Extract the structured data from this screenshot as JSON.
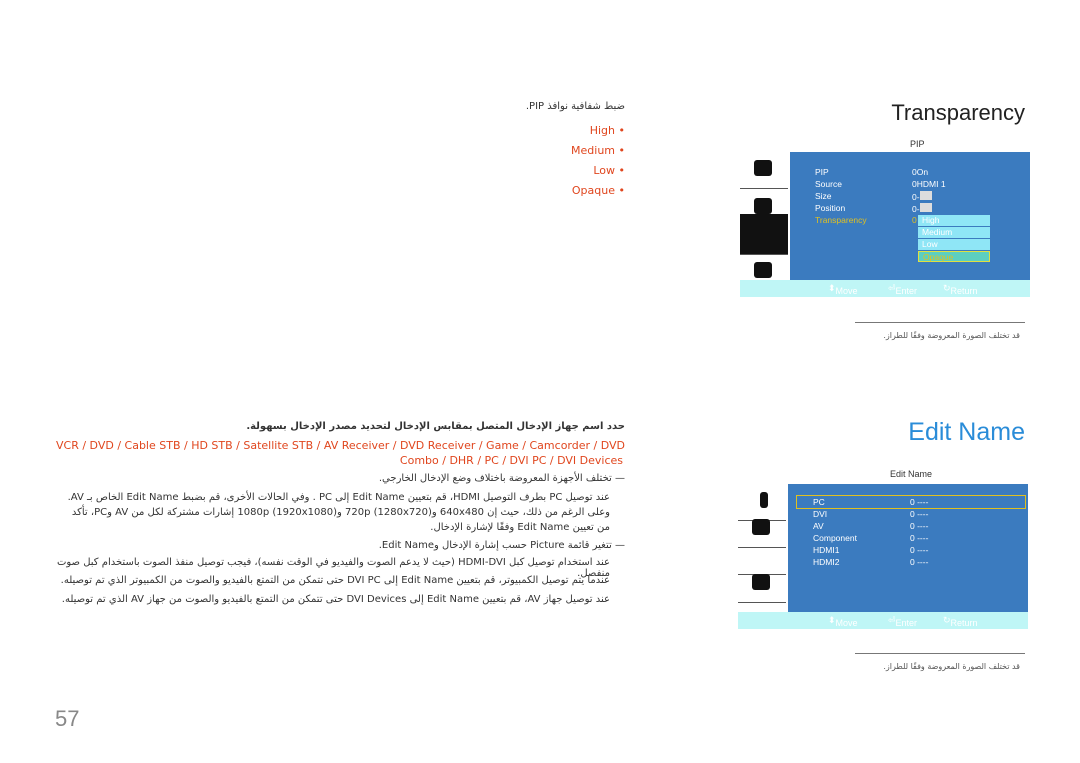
{
  "transparency": {
    "title": "Transparency",
    "intro": "ضبط شفافية نوافذ PIP.",
    "options": [
      "High",
      "Medium",
      "Low",
      "Opaque"
    ],
    "osd": {
      "title": "PIP",
      "rows": [
        {
          "label": "PIP",
          "value": "On"
        },
        {
          "label": "Source",
          "value": "HDMI 1"
        },
        {
          "label": "Size",
          "value": ""
        },
        {
          "label": "Position",
          "value": ""
        },
        {
          "label": "Transparency",
          "value": ""
        }
      ],
      "dropdown": [
        "High",
        "Medium",
        "Low",
        "Opaque"
      ],
      "footer": {
        "move": "Move",
        "enter": "Enter",
        "return": "Return"
      }
    },
    "note": "قد تختلف الصورة المعروضة وفقًا للطراز."
  },
  "edit_name": {
    "title": "Edit Name",
    "intro": "حدد اسم جهاز الإدخال المتصل بمقابس الإدخال لتحديد مصدر الإدخال بسهولة.",
    "devices_line1": "VCR / DVD / Cable STB / HD STB / Satellite STB / AV Receiver / DVD Receiver / Game / Camcorder / DVD",
    "devices_line2": "Combo / DHR / PC / DVI PC / DVI Devices",
    "note1": "تختلف الأجهزة المعروضة باختلاف وضع الإدخال الخارجي.",
    "para1": "عند توصيل PC بطرف التوصيل HDMI، قم بتعيين Edit Name إلى PC . وفي الحالات الأخرى، قم بضبط Edit Name الخاص بـ AV. وعلى الرغم من ذلك، حيث إن 640x480 و720p (1280x720) و1080p (1920x1080) إشارات مشتركة لكل من AV وPC، تأكد من تعيين Edit Name وفقًا لإشارة الإدخال.",
    "note2": "تتغير قائمة Picture حسب إشارة الإدخال وEdit Name.",
    "para2": "عند استخدام توصيل كبل HDMI-DVI (حيث لا يدعم الصوت والفيديو في الوقت نفسه)، فيجب توصيل منفذ الصوت باستخدام كبل صوت منفصل.",
    "para3": "عندما يتم توصيل الكمبيوتر، قم بتعيين Edit Name إلى DVI PC حتى تتمكن من التمتع بالفيديو والصوت من الكمبيوتر الذي تم توصيله.",
    "para4": "عند توصيل جهاز AV، قم بتعيين Edit Name إلى DVI Devices حتى تتمكن من التمتع بالفيديو والصوت من جهاز AV الذي تم توصيله.",
    "osd": {
      "title": "Edit Name",
      "rows": [
        {
          "label": "PC",
          "value": "----"
        },
        {
          "label": "DVI",
          "value": "----"
        },
        {
          "label": "AV",
          "value": "----"
        },
        {
          "label": "Component",
          "value": "----"
        },
        {
          "label": "HDMI1",
          "value": "----"
        },
        {
          "label": "HDMI2",
          "value": "----"
        }
      ],
      "footer": {
        "move": "Move",
        "enter": "Enter",
        "return": "Return"
      }
    },
    "note": "قد تختلف الصورة المعروضة وفقًا للطراز."
  },
  "page_number": "57",
  "colors": {
    "accent": "#e0461e",
    "heading": "#2a8cd8",
    "osd_panel": "#3b7bbf",
    "osd_footer": "#bff6f6",
    "highlight": "#e0c020"
  }
}
